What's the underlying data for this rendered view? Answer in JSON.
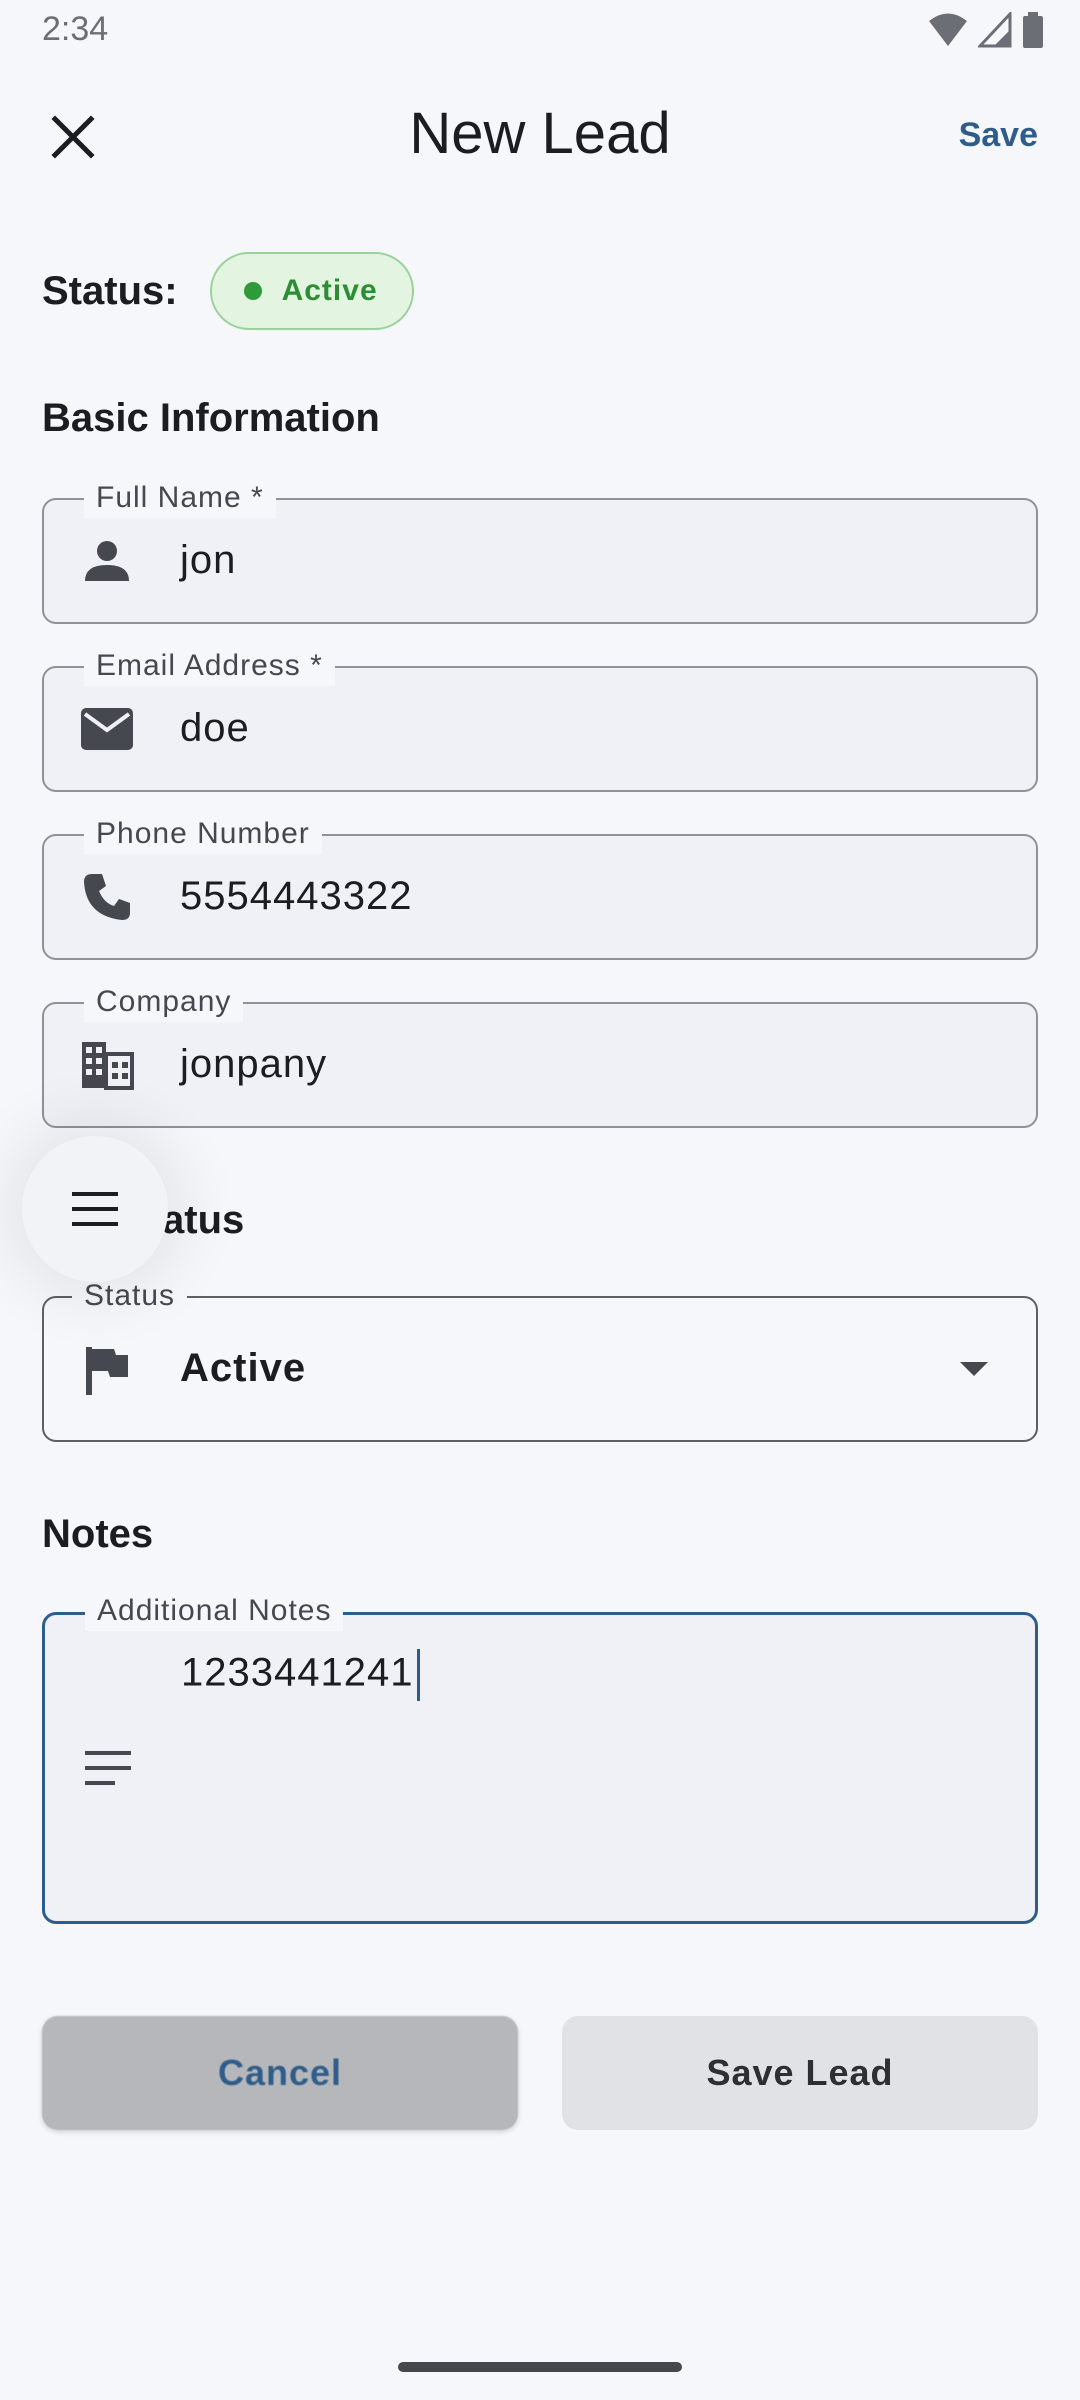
{
  "status_bar": {
    "time": "2:34"
  },
  "app_bar": {
    "title": "New Lead",
    "save_label": "Save"
  },
  "status_row": {
    "label": "Status:",
    "chip_text": "Active",
    "chip_color": "#2e9a3a"
  },
  "sections": {
    "basic": "Basic Information",
    "status": "Status",
    "notes": "Notes"
  },
  "fields": {
    "full_name": {
      "label": "Full Name *",
      "value": "jon",
      "icon": "person-icon"
    },
    "email": {
      "label": "Email Address *",
      "value": "doe",
      "icon": "mail-icon"
    },
    "phone": {
      "label": "Phone Number",
      "value": "5554443322",
      "icon": "phone-icon"
    },
    "company": {
      "label": "Company",
      "value": "jonpany",
      "icon": "business-icon"
    },
    "status": {
      "label": "Status",
      "value": "Active",
      "icon": "flag-icon"
    },
    "notes": {
      "label": "Additional Notes",
      "value": "1233441241",
      "icon": "notes-icon"
    }
  },
  "buttons": {
    "cancel": "Cancel",
    "save_lead": "Save Lead"
  },
  "colors": {
    "accent": "#2f5d8a",
    "background": "#f5f7fb"
  }
}
